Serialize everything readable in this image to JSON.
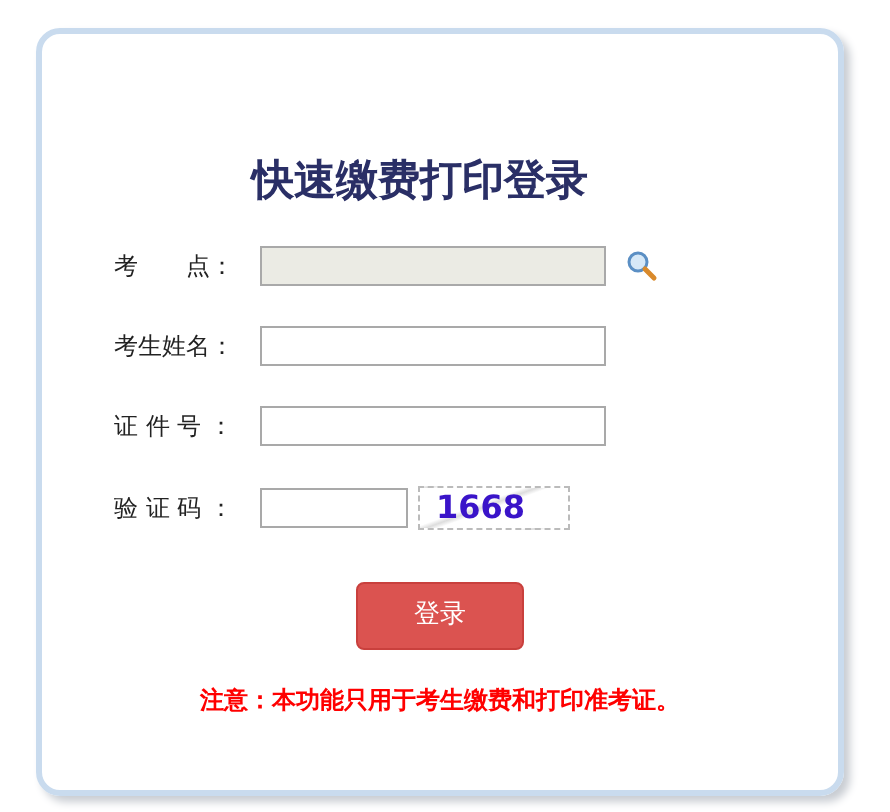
{
  "title": "快速缴费打印登录",
  "fields": [
    {
      "label": "考　　点：",
      "kind": "select",
      "disabled": true
    },
    {
      "label": "考生姓名：",
      "kind": "text",
      "disabled": false
    },
    {
      "label": "证 件 号 ：",
      "kind": "text",
      "disabled": false
    },
    {
      "label": "验 证 码 ：",
      "kind": "captcha",
      "disabled": false,
      "captcha": "1668"
    }
  ],
  "button": "登录",
  "notice": "注意：本功能只用于考生缴费和打印准考证。"
}
